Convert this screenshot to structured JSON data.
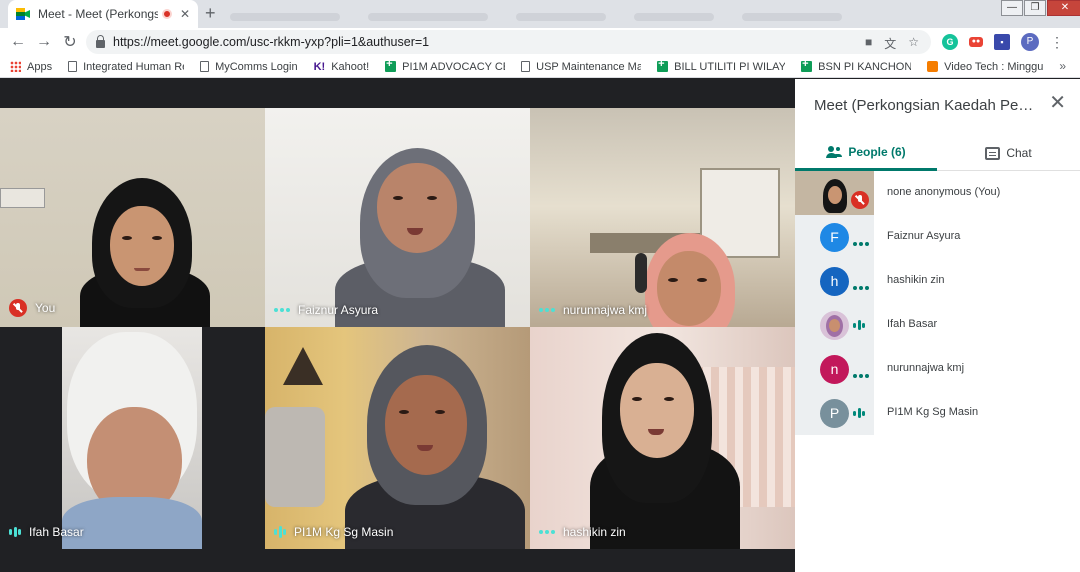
{
  "browser": {
    "tab_title": "Meet - Meet (Perkongsian K",
    "tab_close": "✕",
    "new_tab": "+",
    "url": "https://meet.google.com/usc-rkkm-yxp?pli=1&authuser=1",
    "profile_initial": "P",
    "window_controls": {
      "minimize": "—",
      "maximize": "❐",
      "close": "✕"
    }
  },
  "bookmarks": [
    {
      "label": "Apps",
      "icon": "apps-icon"
    },
    {
      "label": "Integrated Human Re",
      "icon": "doc-icon"
    },
    {
      "label": "MyComms Login",
      "icon": "doc-icon"
    },
    {
      "label": "Kahoot!",
      "icon": "kahoot-icon",
      "glyph": "K!"
    },
    {
      "label": "PI1M ADVOCACY CE",
      "icon": "sheet-icon"
    },
    {
      "label": "USP Maintenance Ma",
      "icon": "doc-icon"
    },
    {
      "label": "BILL UTILITI PI WILAY",
      "icon": "sheet-icon"
    },
    {
      "label": "BSN PI KANCHONG",
      "icon": "sheet-icon"
    },
    {
      "label": "Video Tech : Minggu",
      "icon": "blogger-icon"
    }
  ],
  "bookmarks_more": "»",
  "tiles": [
    {
      "name": "You",
      "indicator": "mic-off"
    },
    {
      "name": "Faiznur Asyura",
      "indicator": "dots"
    },
    {
      "name": "nurunnajwa kmj",
      "indicator": "dots"
    },
    {
      "name": "Ifah Basar",
      "indicator": "bars"
    },
    {
      "name": "PI1M Kg Sg Masin",
      "indicator": "bars"
    },
    {
      "name": "hashikin zin",
      "indicator": "dots"
    }
  ],
  "panel": {
    "title": "Meet (Perkongsian Kaedah Pemb...",
    "close": "✕",
    "people_tab": "People (6)",
    "chat_tab": "Chat",
    "participants": [
      {
        "name": "none anonymous (You)",
        "kind": "video",
        "indicator": "mic-off"
      },
      {
        "name": "Faiznur Asyura",
        "kind": "letter",
        "initial": "F",
        "color": "#1e88e5",
        "indicator": "dots"
      },
      {
        "name": "hashikin zin",
        "kind": "letter",
        "initial": "h",
        "color": "#1565c0",
        "indicator": "dots"
      },
      {
        "name": "Ifah Basar",
        "kind": "photo",
        "initial": "",
        "color": "#d9c2d8",
        "indicator": "bars"
      },
      {
        "name": "nurunnajwa kmj",
        "kind": "letter",
        "initial": "n",
        "color": "#c2185b",
        "indicator": "dots"
      },
      {
        "name": "PI1M Kg Sg Masin",
        "kind": "letter",
        "initial": "P",
        "color": "#78909c",
        "indicator": "bars"
      }
    ]
  },
  "colors": {
    "accent": "#00796b",
    "mic_off": "#d93025",
    "speaking": "#4ce0d5"
  }
}
